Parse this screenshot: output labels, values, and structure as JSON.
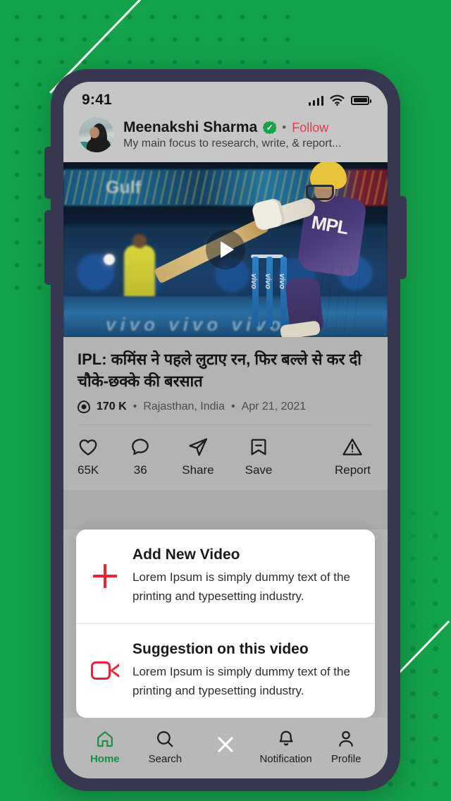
{
  "background": {
    "base_color": "#14a24a",
    "dot_color": "#0d8a3c",
    "line_color": "#ffffff"
  },
  "phone": {
    "frame_color": "#373751",
    "screen_bg": "#b3b3b3"
  },
  "status_bar": {
    "time": "9:41",
    "signal_icon": "signal-bars-icon",
    "wifi_icon": "wifi-icon",
    "battery_icon": "battery-icon"
  },
  "author": {
    "avatar_icon": "avatar",
    "name": "Meenakshi Sharma",
    "verified_icon": "verified-badge-icon",
    "separator": "•",
    "follow_label": "Follow",
    "follow_color": "#e8384f",
    "bio": "My main focus to research, write, & report..."
  },
  "video": {
    "play_icon": "play-icon",
    "sponsor_top": "Gulf",
    "sponsor_board": "vivo  vivo  vivo",
    "jersey_text": "MPL"
  },
  "article": {
    "title": "IPL: कमिंस ने पहले लुटाए रन, फिर बल्ले से कर दी चौके-छक्के की बरसात",
    "views_icon": "eye-icon",
    "views": "170 K",
    "sep1": "•",
    "location": "Rajasthan, India",
    "sep2": "•",
    "date": "Apr 21, 2021"
  },
  "actions": [
    {
      "icon": "heart-icon",
      "label": "65K"
    },
    {
      "icon": "comment-icon",
      "label": "36"
    },
    {
      "icon": "share-icon",
      "label": "Share"
    },
    {
      "icon": "bookmark-icon",
      "label": "Save"
    }
  ],
  "report": {
    "icon": "warning-triangle-icon",
    "label": "Report"
  },
  "sheet": {
    "accent_color": "#ee2233",
    "items": [
      {
        "icon": "plus-icon",
        "title": "Add New Video",
        "description": "Lorem Ipsum is simply dummy text of the printing and typesetting industry."
      },
      {
        "icon": "video-camera-icon",
        "title": "Suggestion on this video",
        "description": "Lorem Ipsum is simply dummy text of the printing and typesetting industry."
      }
    ]
  },
  "bottom_nav": {
    "active_color": "#149141",
    "items": [
      {
        "icon": "home-icon",
        "label": "Home",
        "active": true
      },
      {
        "icon": "search-icon",
        "label": "Search",
        "active": false
      },
      {
        "icon": "notification-bell-icon",
        "label": "Notification",
        "active": false
      },
      {
        "icon": "profile-icon",
        "label": "Profile",
        "active": false
      }
    ],
    "close_icon": "close-icon"
  }
}
